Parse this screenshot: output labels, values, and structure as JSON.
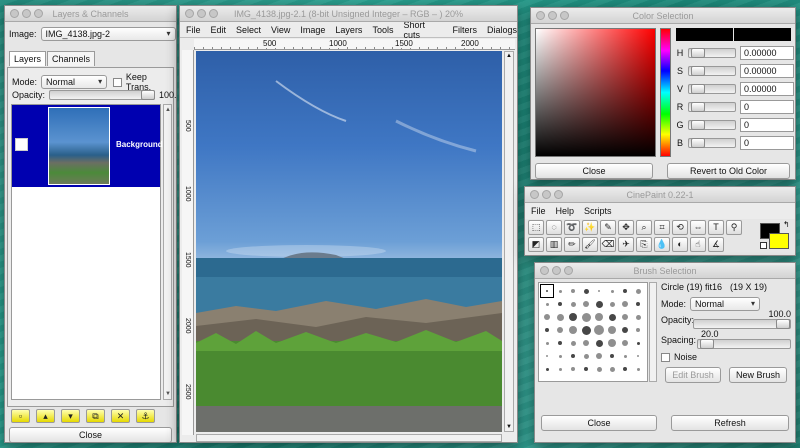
{
  "colors": {
    "layer_selected_bg": "#0000b0",
    "fg_color": "#000000",
    "bg_color": "#ffff00"
  },
  "layers_window": {
    "title": "Layers & Channels",
    "image_label": "Image:",
    "image_value": "IMG_4138.jpg-2",
    "tabs": [
      {
        "label": "Layers"
      },
      {
        "label": "Channels"
      }
    ],
    "mode_label": "Mode:",
    "mode_value": "Normal",
    "keep_trans_label": "Keep Trans.",
    "opacity_label": "Opacity:",
    "opacity_value": "100.0",
    "layer_name": "Background",
    "bottom_icons": [
      "new-layer-icon",
      "raise-layer-icon",
      "lower-layer-icon",
      "duplicate-layer-icon",
      "delete-layer-icon",
      "anchor-layer-icon"
    ],
    "close_label": "Close"
  },
  "image_window": {
    "title": "IMG_4138.jpg-2.1 (8-bit Unsigned Integer – RGB – ) 20%",
    "menu": [
      "File",
      "Edit",
      "Select",
      "View",
      "Image",
      "Layers",
      "Tools",
      "Short cuts",
      "Filters",
      "Dialogs"
    ],
    "ruler_h": [
      "500",
      "1000",
      "1500",
      "2000"
    ],
    "ruler_v": [
      "500",
      "1000",
      "1500",
      "2000",
      "2500"
    ]
  },
  "color_window": {
    "title": "Color Selection",
    "channels": [
      {
        "label": "H",
        "value": "0.00000"
      },
      {
        "label": "S",
        "value": "0.00000"
      },
      {
        "label": "V",
        "value": "0.00000"
      },
      {
        "label": "R",
        "value": "0"
      },
      {
        "label": "G",
        "value": "0"
      },
      {
        "label": "B",
        "value": "0"
      }
    ],
    "close_label": "Close",
    "revert_label": "Revert to Old Color"
  },
  "cinepaint_window": {
    "title": "CinePaint 0.22-1",
    "menu": [
      "File",
      "Help",
      "Scripts"
    ],
    "tools_row1": [
      "rect-select-icon",
      "ellipse-select-icon",
      "lasso-icon",
      "magic-wand-icon",
      "bezier-icon",
      "move-icon",
      "zoom-icon",
      "crop-icon",
      "transform-icon",
      "flip-icon",
      "text-icon",
      "eyedropper-icon"
    ],
    "tools_row2": [
      "bucket-fill-icon",
      "gradient-icon",
      "pencil-icon",
      "paintbrush-icon",
      "eraser-icon",
      "airbrush-icon",
      "clone-icon",
      "blur-icon",
      "dodge-icon",
      "smudge-icon",
      "measure-icon"
    ]
  },
  "brush_window": {
    "title": "Brush Selection",
    "brush_name": "Circle (19) fit16",
    "brush_size": "(19 X 19)",
    "mode_label": "Mode:",
    "mode_value": "Normal",
    "opacity_label": "Opacity:",
    "opacity_value": "100.0",
    "spacing_label": "Spacing:",
    "spacing_value": "20.0",
    "noise_label": "Noise",
    "edit_brush_label": "Edit Brush",
    "new_brush_label": "New Brush",
    "close_label": "Close",
    "refresh_label": "Refresh"
  }
}
